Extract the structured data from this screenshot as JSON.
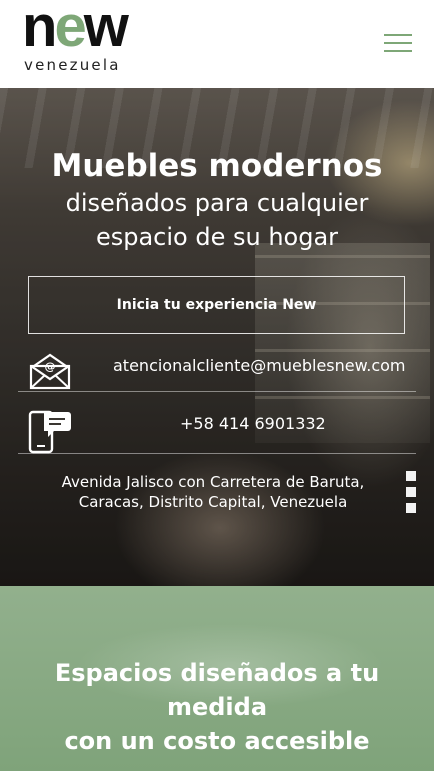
{
  "header": {
    "logo_word_n": "n",
    "logo_word_e": "e",
    "logo_word_w": "w",
    "logo_sub": "venezuela",
    "menu_icon": "hamburger-menu-icon"
  },
  "hero": {
    "title": "Muebles modernos",
    "subtitle": "diseñados para cualquier espacio de su hogar",
    "cta_label": "Inicia tu experiencia New",
    "email": "atencionalcliente@mueblesnew.com",
    "email_icon": "email-envelope-icon",
    "phone": "+58 414 6901332",
    "phone_icon": "phone-chat-icon",
    "address_line1": "Avenida Jalisco con Carretera de Baruta,",
    "address_line2": "Caracas, Distrito Capital, Venezuela"
  },
  "section2": {
    "title_line1": "Espacios diseñados a tu",
    "title_line2": "medida",
    "title_line3": "con un costo accesible"
  },
  "colors": {
    "brand_green": "#7ea777",
    "section_green": "#87a982",
    "text_white": "#ffffff"
  }
}
